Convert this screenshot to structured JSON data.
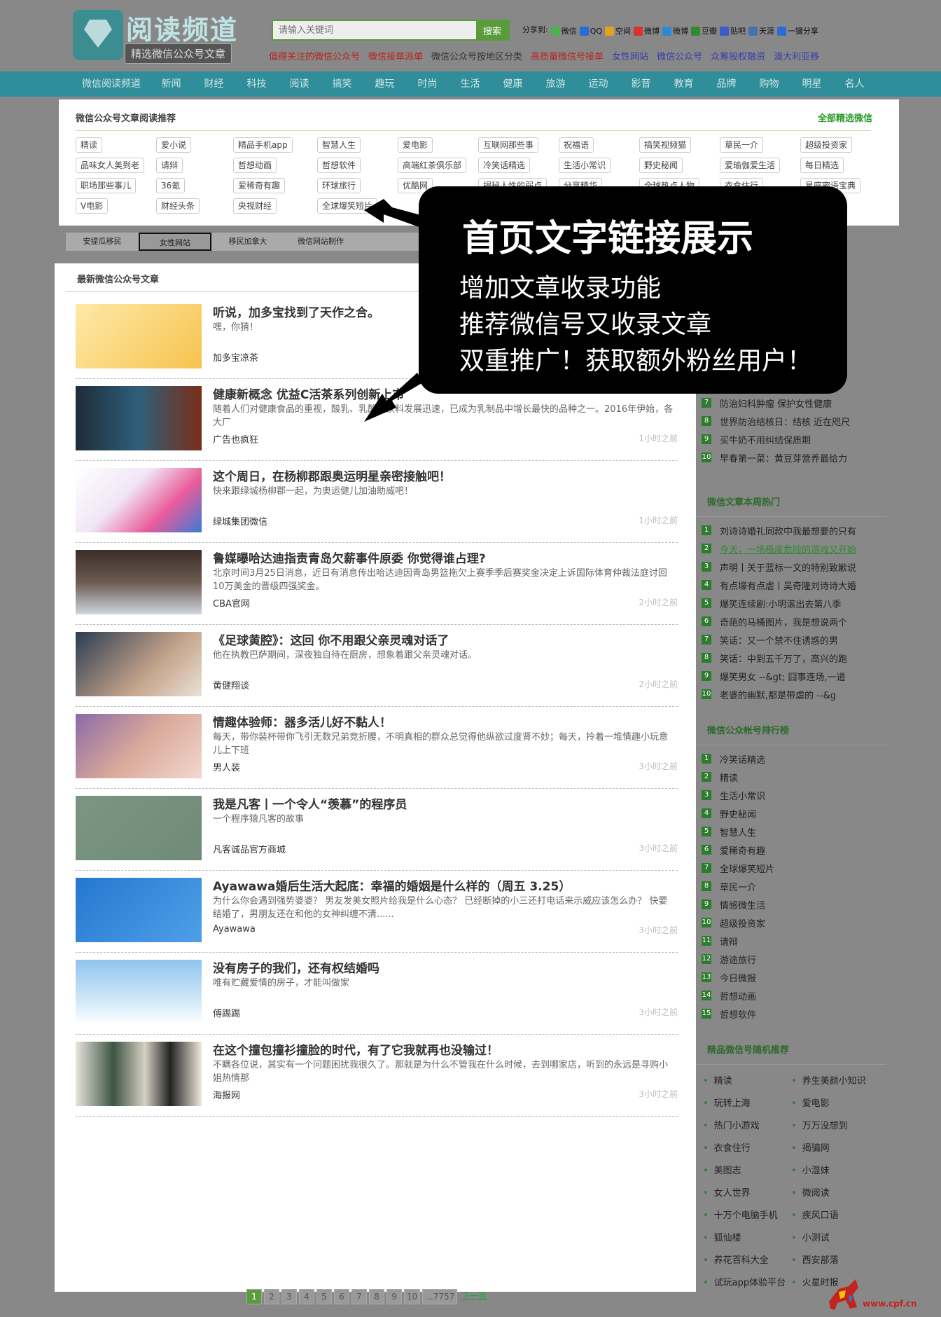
{
  "header": {
    "logo_title": "阅读频道",
    "logo_subtitle": "精选微信公众号文章",
    "search_placeholder": "请输入关键词",
    "search_button": "搜索",
    "share_label": "分享到:",
    "share_items": [
      {
        "label": "微信",
        "color": "#4cb14c"
      },
      {
        "label": "QQ",
        "color": "#2a6bd6"
      },
      {
        "label": "空间",
        "color": "#e3a21b"
      },
      {
        "label": "微博",
        "color": "#d8322c"
      },
      {
        "label": "微博",
        "color": "#2a8ad6"
      },
      {
        "label": "豆瓣",
        "color": "#2e8b2e"
      },
      {
        "label": "贴吧",
        "color": "#3a5cc4"
      },
      {
        "label": "天涯",
        "color": "#4670b0"
      },
      {
        "label": "一键分享",
        "color": "#2a6bd6"
      }
    ],
    "hot_links": [
      {
        "label": "值得关注的微信公众号",
        "color": "#b22"
      },
      {
        "label": "微信接单派单",
        "color": "#b22"
      },
      {
        "label": "微信公众号按地区分类",
        "color": "#333"
      },
      {
        "label": "高质量微信号接单",
        "color": "#b22"
      },
      {
        "label": "女性网站",
        "color": "#3a3ab0"
      },
      {
        "label": "微信公众号",
        "color": "#3a3ab0"
      },
      {
        "label": "众筹股权融资",
        "color": "#3a3ab0"
      },
      {
        "label": "澳大利亚移",
        "color": "#3a3ab0"
      }
    ]
  },
  "nav": [
    "微信阅读频道",
    "新闻",
    "财经",
    "科技",
    "阅读",
    "搞笑",
    "趣玩",
    "时尚",
    "生活",
    "健康",
    "旅游",
    "运动",
    "影音",
    "教育",
    "品牌",
    "购物",
    "明星",
    "名人"
  ],
  "recommend": {
    "title": "微信公众号文章阅读推荐",
    "all_link": "全部精选微信",
    "rows": [
      [
        "精读",
        "爱小说",
        "精品手机app",
        "智慧人生",
        "爱电影",
        "互联网那些事",
        "祝福语",
        "搞笑视频猫",
        "草民一介",
        "超级投资家"
      ],
      [
        "品味女人美到老",
        "请辩",
        "哲想动画",
        "哲想软件",
        "高端红茶俱乐部",
        "冷笑话精选",
        "生活小常识",
        "野史秘闻",
        "爱瑜伽爱生活",
        "每日精选"
      ],
      [
        "职场那些事儿",
        "36氪",
        "爱稀奇有趣",
        "环球旅行",
        "优酷网",
        "揭秘人性的弱点",
        "分享精华",
        "全球热点人物",
        "衣食住行",
        "星座密语宝典"
      ],
      [
        "V电影",
        "财经头条",
        "央视财经",
        "全球爆笑短片"
      ]
    ]
  },
  "subtabs": [
    "安提瓜移民",
    "女性网站",
    "移民加拿大",
    "微信网站制作"
  ],
  "main": {
    "title": "最新微信公众号文章",
    "articles": [
      {
        "title": "听说，加多宝找到了天作之合。",
        "desc": "嘿，你猜！",
        "source": "加多宝凉茶",
        "time": ""
      },
      {
        "title": "健康新概念 优益C活茶系列创新上市",
        "desc": "随着人们对健康食品的重视，酸乳、乳酸菌饮料发展迅速，已成为乳制品中增长最快的品种之一。2016年伊始，各大厂",
        "source": "广告也疯狂",
        "time": "1小时之前"
      },
      {
        "title": "这个周日，在杨柳郡跟奥运明星亲密接触吧！",
        "desc": "快来跟绿城杨柳郡一起，为奥运健儿加油助威吧！",
        "source": "绿城集团微信",
        "time": "1小时之前"
      },
      {
        "title": "鲁媒曝哈达迪指责青岛欠薪事件原委 你觉得谁占理?",
        "desc": "北京时间3月25日消息，近日有消息传出哈达迪因青岛男篮拖欠上赛季季后赛奖金决定上诉国际体育仲裁法庭讨回10万美金的晋级四强奖金。",
        "source": "CBA官网",
        "time": "2小时之前"
      },
      {
        "title": "《足球黄腔》：这回 你不用跟父亲灵魂对话了",
        "desc": "他在执教巴萨期间，深夜独自待在厨房，想象着跟父亲灵魂对话。",
        "source": "黄健翔谈",
        "time": "2小时之前"
      },
      {
        "title": "情趣体验师：器多活儿好不黏人！",
        "desc": "每天，带你装杯带你飞引无数兄弟竞折腰，不明真相的群众总觉得他纵欲过度肾不妙；每天，拎着一堆情趣小玩意儿上下班",
        "source": "男人装",
        "time": "3小时之前"
      },
      {
        "title": "我是凡客丨一个令人“羡慕”的程序员",
        "desc": "一个程序猿凡客的故事",
        "source": "凡客诚品官方商城",
        "time": "3小时之前"
      },
      {
        "title": "Ayawawa婚后生活大起底：幸福的婚姻是什么样的（周五 3.25）",
        "desc": "为什么你会遇到强势婆婆？ 男友发美女照片给我是什么心态？ 已经断掉的小三还打电话来示威应该怎么办？ 快要结婚了，男朋友还在和他的女神纠缠不清......",
        "source": "Ayawawa",
        "time": "3小时之前"
      },
      {
        "title": "没有房子的我们，还有权结婚吗",
        "desc": "唯有贮藏爱情的房子，才能叫做家",
        "source": "傅踢踢",
        "time": "3小时之前"
      },
      {
        "title": "在这个撞包撞衫撞脸的时代，有了它我就再也没输过！",
        "desc": "不瞒各位说，其实有一个问题困扰我很久了。那就是为什么不管我在什么时候，去到哪家店，听到的永远是寻购小姐热情那",
        "source": "海报网",
        "time": "3小时之前"
      }
    ]
  },
  "pager": {
    "pages": [
      "1",
      "2",
      "3",
      "4",
      "5",
      "6",
      "7",
      "8",
      "9",
      "10",
      "...7757"
    ],
    "next": "下一页"
  },
  "sidebar": {
    "top_partial": [
      {
        "num": "7",
        "text": "防治妇科肿瘤 保护女性健康"
      },
      {
        "num": "8",
        "text": "世界防治结核日：结核 近在咫尺"
      },
      {
        "num": "9",
        "text": "买牛奶不用纠结保质期"
      },
      {
        "num": "10",
        "text": "早春第一菜：黄豆芽营养最给力"
      }
    ],
    "week_hot": {
      "title": "微信文章本周热门",
      "items": [
        "刘诗诗婚礼同款中我最想要的只有",
        "今天，一场极度危险的游戏又开始",
        "声明丨关于蓝标一文的特别致歉说",
        "有点壕有点虐丨吴奇隆刘诗诗大婚",
        "爆笑连续剧:小明滚出去第八季",
        "奇葩的马桶图片，我是想说两个",
        "笑话：又一个禁不住诱惑的男",
        "笑话：中到五千万了，高兴的跑",
        "爆笑男女 --&gt; 囧事连场,一道",
        "老婆的幽默,都是带虐的 --&g"
      ]
    },
    "rank": {
      "title": "微信公众帐号排行榜",
      "items": [
        "冷笑话精选",
        "精读",
        "生活小常识",
        "野史秘闻",
        "智慧人生",
        "爱稀奇有趣",
        "全球爆笑短片",
        "草民一介",
        "情感微生活",
        "超级投资家",
        "请辩",
        "游途旅行",
        "今日微报",
        "哲想动画",
        "哲想软件"
      ]
    },
    "random": {
      "title": "精品微信号随机推荐",
      "items": [
        "精读",
        "养生美颜小知识",
        "玩转上海",
        "爱电影",
        "热门小游戏",
        "万万没想到",
        "衣食住行",
        "揭骗网",
        "美图志",
        "小湿妹",
        "女人世界",
        "微阅读",
        "十万个电脑手机",
        "疾风口语",
        "狐仙楼",
        "小测试",
        "养花百科大全",
        "西安部落",
        "试玩app体验平台",
        "火星时报"
      ]
    }
  },
  "callout": {
    "heading": "首页文字链接展示",
    "lines": [
      "增加文章收录功能",
      "推荐微信号又收录文章",
      "双重推广！获取额外粉丝用户！"
    ]
  },
  "watermark": "www.cpf.cn"
}
